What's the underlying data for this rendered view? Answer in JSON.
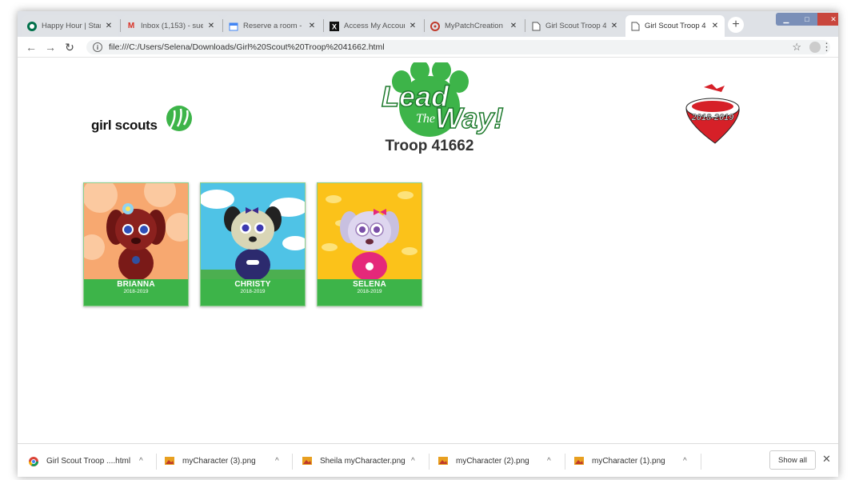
{
  "browser": {
    "tabs": [
      {
        "title": "Happy Hour | Starb",
        "icon": "starbucks-icon",
        "color": "#00704a"
      },
      {
        "title": "Inbox (1,153) - sue",
        "icon": "gmail-icon",
        "color": "#d93025"
      },
      {
        "title": "Reserve a room - S",
        "icon": "calendar-icon",
        "color": "#4285f4"
      },
      {
        "title": "Access My Accoun",
        "icon": "x-logo-icon",
        "color": "#111111"
      },
      {
        "title": "MyPatchCreation",
        "icon": "patch-icon",
        "color": "#c0392b"
      },
      {
        "title": "Girl Scout Troop 4",
        "icon": "page-icon",
        "color": "#555555"
      },
      {
        "title": "Girl Scout Troop 4",
        "icon": "page-icon",
        "color": "#555555"
      }
    ],
    "url": "file:///C:/Users/Selena/Downloads/Girl%20Scout%20Troop%2041662.html"
  },
  "page": {
    "gs_logo_text": "girl scouts",
    "lead": "Lead",
    "the": "The",
    "way": "Way!",
    "troop_title": "Troop 41662",
    "bandana_year": "2018-2019",
    "cards": [
      {
        "name": "BRIANNA",
        "year": "2018-2019"
      },
      {
        "name": "CHRISTY",
        "year": "2018-2019"
      },
      {
        "name": "SELENA",
        "year": "2018-2019"
      }
    ]
  },
  "downloads": {
    "items": [
      {
        "name": "Girl Scout Troop ....html",
        "icon": "chrome-icon"
      },
      {
        "name": "myCharacter (3).png",
        "icon": "image-file-icon"
      },
      {
        "name": "Sheila myCharacter.png",
        "icon": "image-file-icon"
      },
      {
        "name": "myCharacter (2).png",
        "icon": "image-file-icon"
      },
      {
        "name": "myCharacter (1).png",
        "icon": "image-file-icon"
      }
    ],
    "show_all": "Show all"
  }
}
